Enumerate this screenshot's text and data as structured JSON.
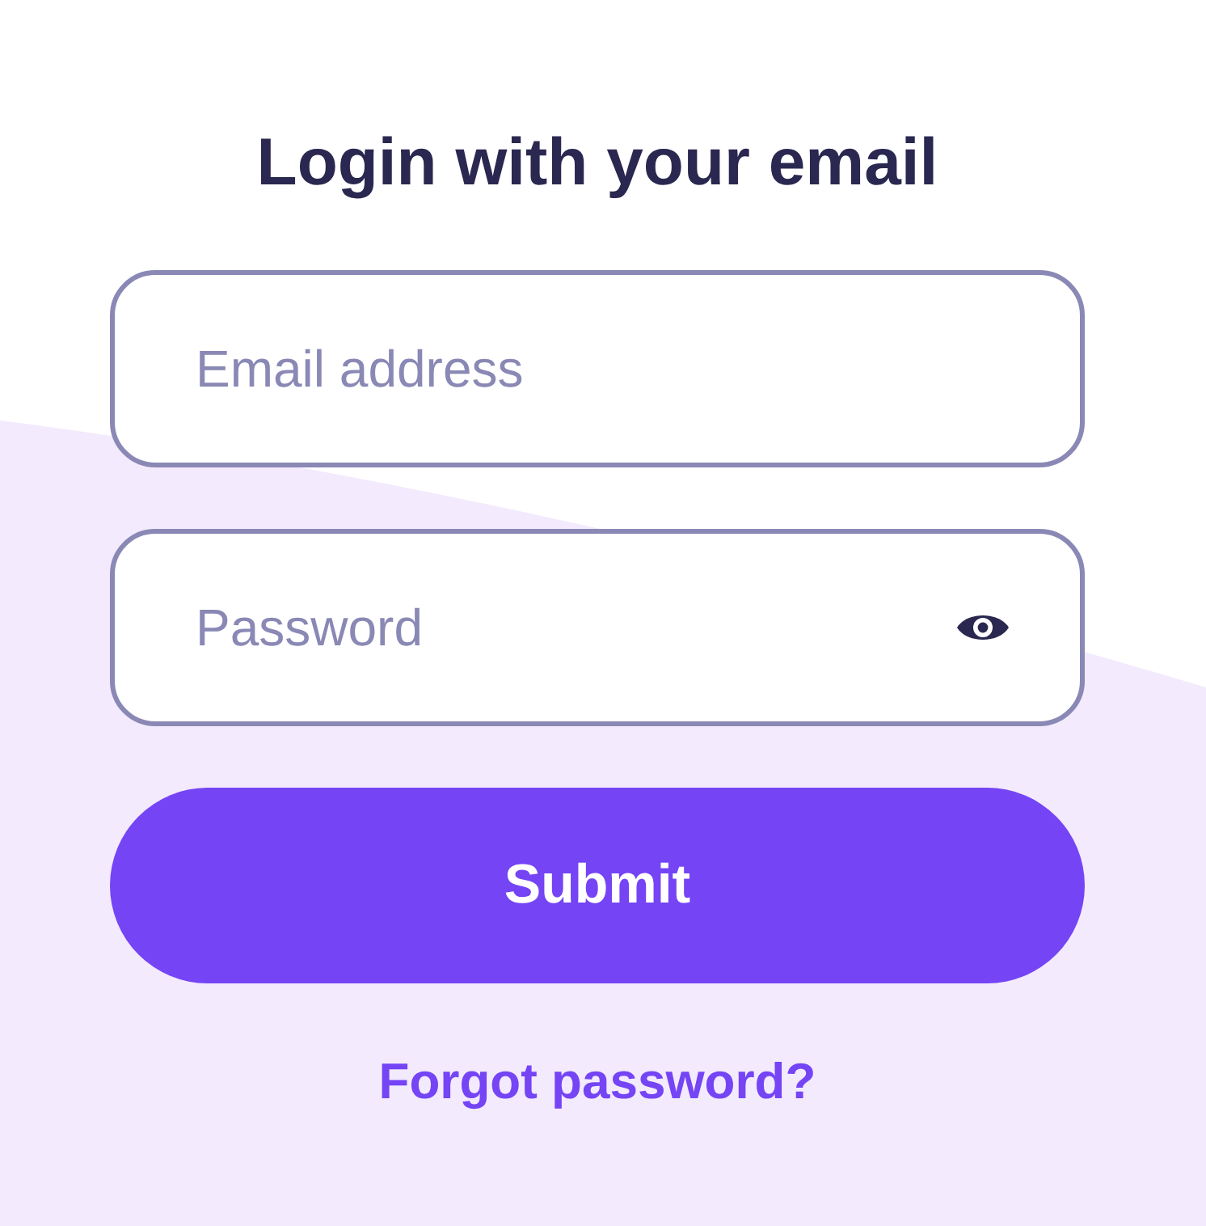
{
  "title": "Login with your email",
  "fields": [
    {
      "kind": "email",
      "placeholder": "Email address"
    },
    {
      "kind": "password",
      "placeholder": "Password"
    }
  ],
  "submit": "Submit",
  "forgot_link": "Forgot password?"
}
